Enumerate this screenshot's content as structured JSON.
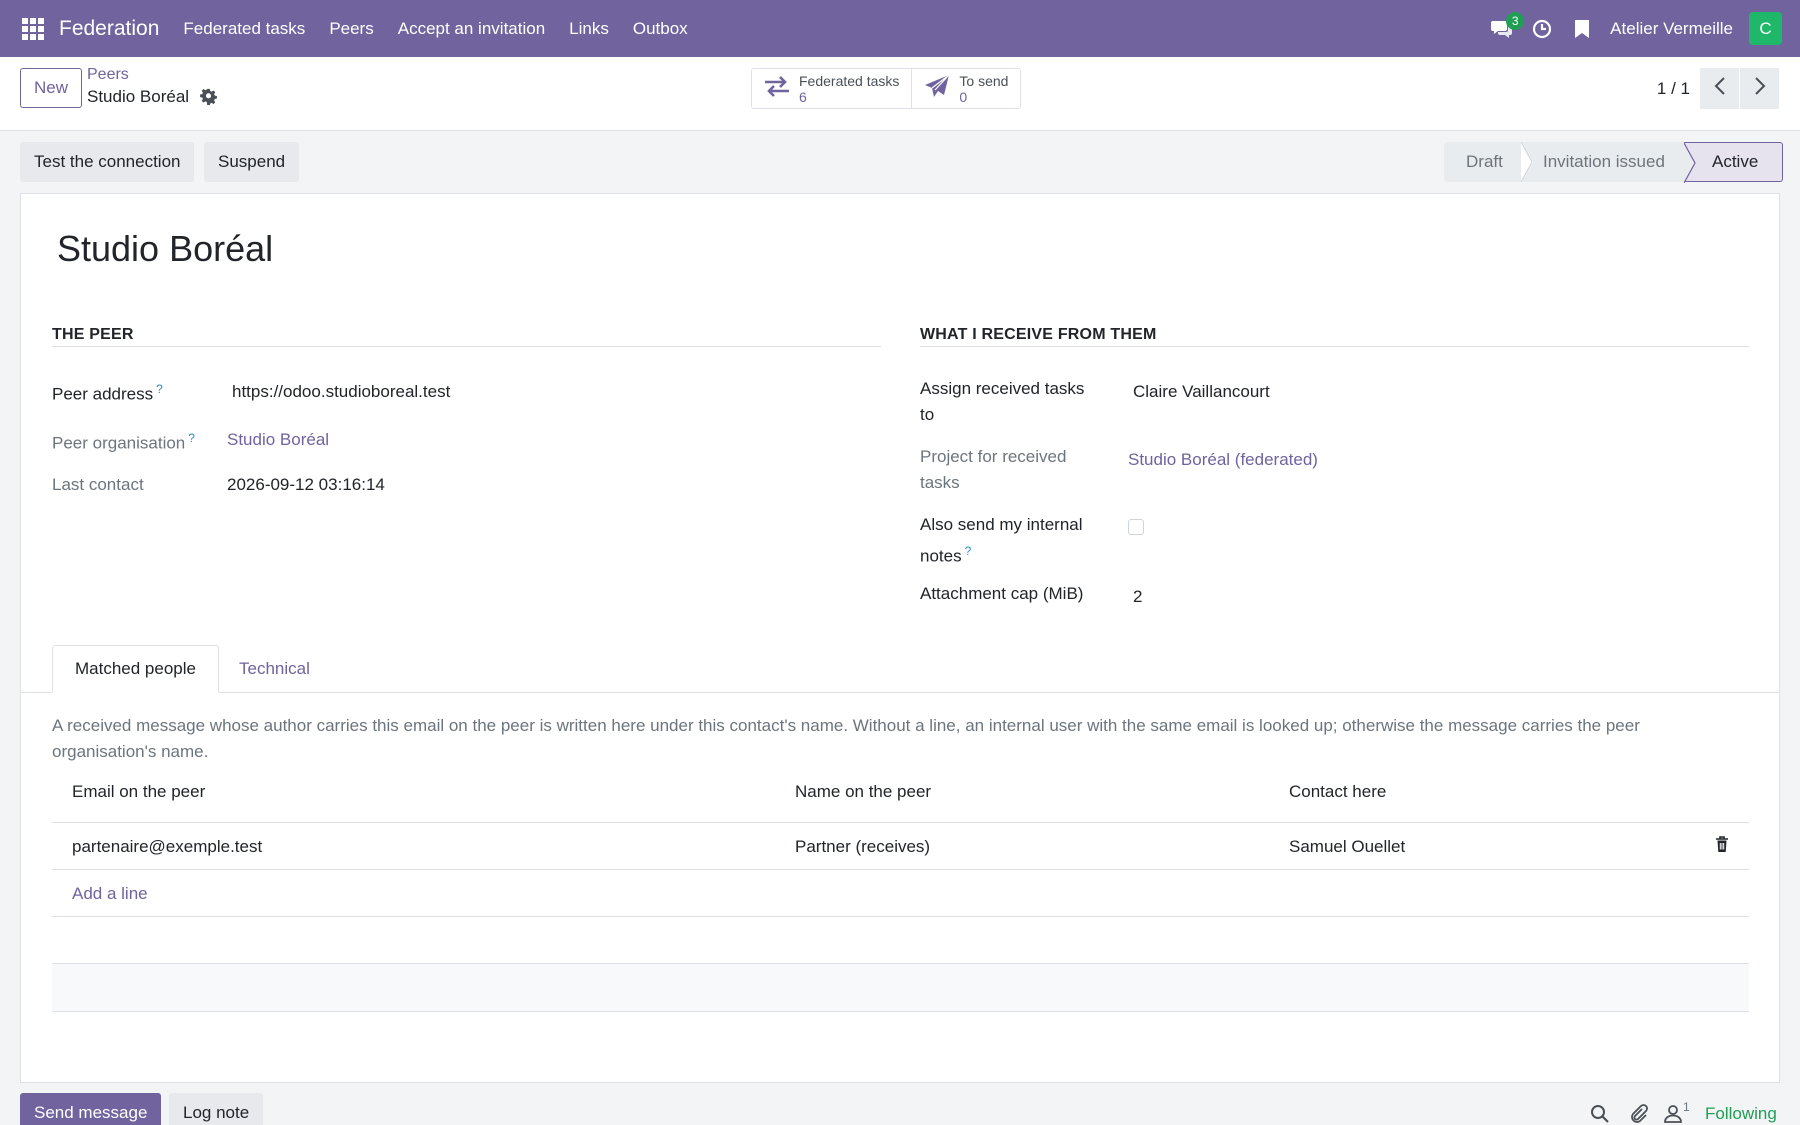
{
  "navbar": {
    "app_name": "Federation",
    "menu": [
      "Federated tasks",
      "Peers",
      "Accept an invitation",
      "Links",
      "Outbox"
    ],
    "messages_badge": "3",
    "company": "Atelier Vermeille",
    "avatar_initial": "C",
    "colors": {
      "bar": "#71639e",
      "avatar": "#1fb86a",
      "badge": "#1f9e54"
    }
  },
  "control_panel": {
    "new_label": "New",
    "breadcrumb_parent": "Peers",
    "breadcrumb_current": "Studio Boréal",
    "smart_buttons": [
      {
        "label": "Federated tasks",
        "value": "6",
        "icon": "arrows-exchange-icon"
      },
      {
        "label": "To send",
        "value": "0",
        "icon": "paper-plane-icon"
      }
    ],
    "pager": "1 / 1"
  },
  "statusbar": {
    "actions": [
      "Test the connection",
      "Suspend"
    ],
    "stages": [
      "Draft",
      "Invitation issued",
      "Active"
    ],
    "current_stage": "Active"
  },
  "form": {
    "title": "Studio Boréal",
    "left_section": {
      "heading": "THE PEER",
      "fields": [
        {
          "label": "Peer address",
          "help": "?",
          "value": "https://odoo.studioboreal.test"
        },
        {
          "label": "Peer organisation",
          "help": "?",
          "value": "Studio Boréal"
        },
        {
          "label": "Last contact",
          "value": "2026-09-12 03:16:14"
        }
      ]
    },
    "right_section": {
      "heading": "WHAT I RECEIVE FROM THEM",
      "fields": [
        {
          "label_line1": "Assign received tasks",
          "label_line2": "to",
          "value": "Claire Vaillancourt"
        },
        {
          "label_line1": "Project for received",
          "label_line2": "tasks",
          "value": "Studio Boréal (federated)"
        },
        {
          "label_line1": "Also send my internal",
          "label_line2": "notes",
          "help": "?",
          "checked": false
        },
        {
          "label_line1": "Attachment cap (MiB)",
          "value": "2"
        }
      ]
    }
  },
  "notebook": {
    "tabs": [
      "Matched people",
      "Technical"
    ],
    "active_tab": "Matched people",
    "help_text": "A received message whose author carries this email on the peer is written here under this contact's name. Without a line, an internal user with the same email is looked up; otherwise the message carries the peer organisation's name.",
    "columns": [
      "Email on the peer",
      "Name on the peer",
      "Contact here"
    ],
    "rows": [
      {
        "email": "partenaire@exemple.test",
        "name": "Partner (receives)",
        "contact": "Samuel Ouellet"
      }
    ],
    "add_line": "Add a line"
  },
  "chatter": {
    "send_message": "Send message",
    "log_note": "Log note",
    "followers_count": "1",
    "following": "Following"
  }
}
